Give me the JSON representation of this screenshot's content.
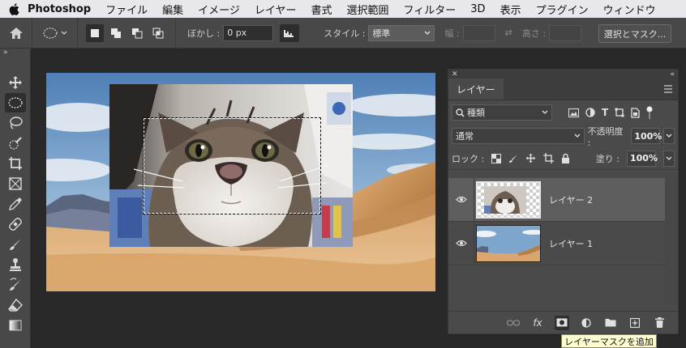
{
  "menubar": {
    "app_name": "Photoshop",
    "items": [
      "ファイル",
      "編集",
      "イメージ",
      "レイヤー",
      "書式",
      "選択範囲",
      "フィルター",
      "3D",
      "表示",
      "プラグイン",
      "ウィンドウ"
    ]
  },
  "options": {
    "feather_label": "ぼかし :",
    "feather_value": "0 px",
    "style_label": "スタイル :",
    "style_value": "標準",
    "width_label": "幅 :",
    "height_label": "高さ :",
    "select_mask_button": "選択とマスク..."
  },
  "layers_panel": {
    "tab_label": "レイヤー",
    "filter_kind": "種類",
    "blend_mode": "通常",
    "opacity_label": "不透明度 :",
    "opacity_value": "100%",
    "lock_label": "ロック :",
    "fill_label": "塗り :",
    "fill_value": "100%",
    "layers": [
      {
        "name": "レイヤー 2",
        "selected": true
      },
      {
        "name": "レイヤー 1",
        "selected": false
      }
    ]
  },
  "tooltip": "レイヤーマスクを追加",
  "colors": {
    "chrome_dark": "#282828",
    "panel": "#4a4a4a",
    "selected_layer": "#5e5e5e",
    "tooltip_bg": "#fffbd0"
  }
}
